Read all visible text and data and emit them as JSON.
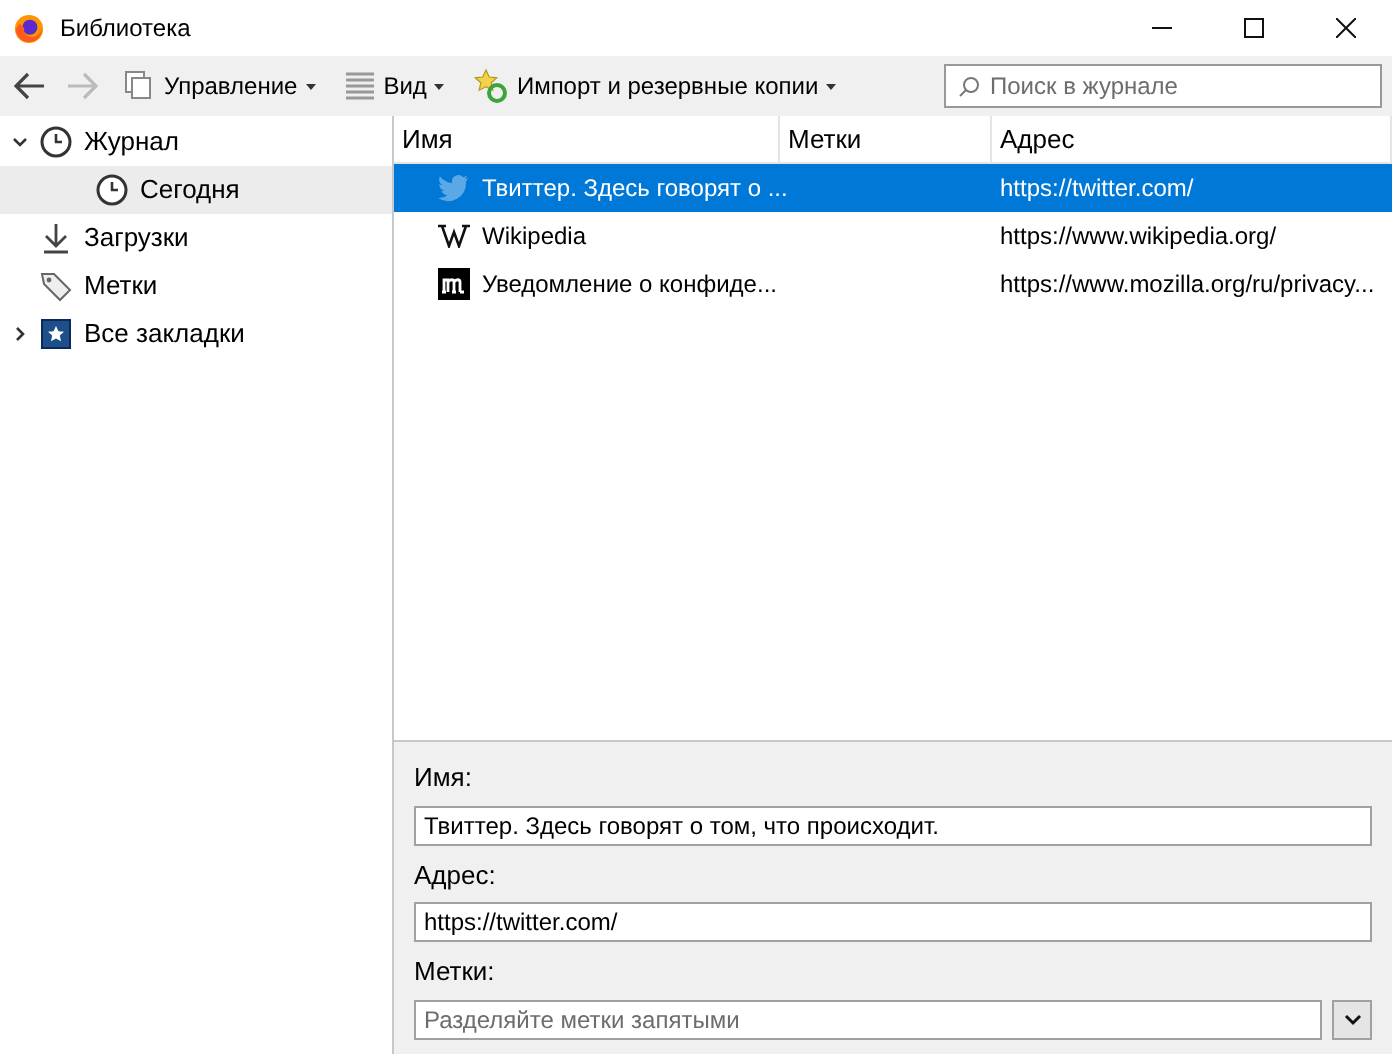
{
  "window": {
    "title": "Библиотека"
  },
  "toolbar": {
    "buttons": [
      {
        "label": "Управление",
        "kind": "organize"
      },
      {
        "label": "Вид",
        "kind": "views"
      },
      {
        "label": "Импорт и резервные копии",
        "kind": "import"
      }
    ],
    "search": {
      "placeholder": "Поиск в журнале"
    }
  },
  "sidebar": {
    "items": [
      {
        "label": "Журнал",
        "kind": "history",
        "selected": false,
        "expanded": true,
        "children": [
          {
            "label": "Сегодня",
            "kind": "history",
            "selected": true
          }
        ]
      },
      {
        "label": "Загрузки",
        "kind": "downloads",
        "selected": false
      },
      {
        "label": "Метки",
        "kind": "tags",
        "selected": false
      },
      {
        "label": "Все закладки",
        "kind": "bookmarks",
        "selected": false,
        "expanded": false
      }
    ]
  },
  "table": {
    "columns": [
      "Имя",
      "Метки",
      "Адрес"
    ],
    "rows": [
      {
        "name": "Твиттер. Здесь говорят о ...",
        "address": "https://twitter.com/",
        "kind": "bird",
        "selected": true
      },
      {
        "name": "Wikipedia",
        "address": "https://www.wikipedia.org/",
        "kind": "wiki",
        "selected": false
      },
      {
        "name": "Уведомление о конфиде...",
        "address": "https://www.mozilla.org/ru/privacy...",
        "kind": "mono",
        "selected": false
      }
    ]
  },
  "details": {
    "fields": [
      {
        "label": "Имя:",
        "value": "Твиттер. Здесь говорят о том, что происходит."
      },
      {
        "label": "Адрес:",
        "value": "https://twitter.com/"
      },
      {
        "label": "Метки:",
        "placeholder": "Разделяйте метки запятыми",
        "kind": "dropdown"
      }
    ]
  }
}
